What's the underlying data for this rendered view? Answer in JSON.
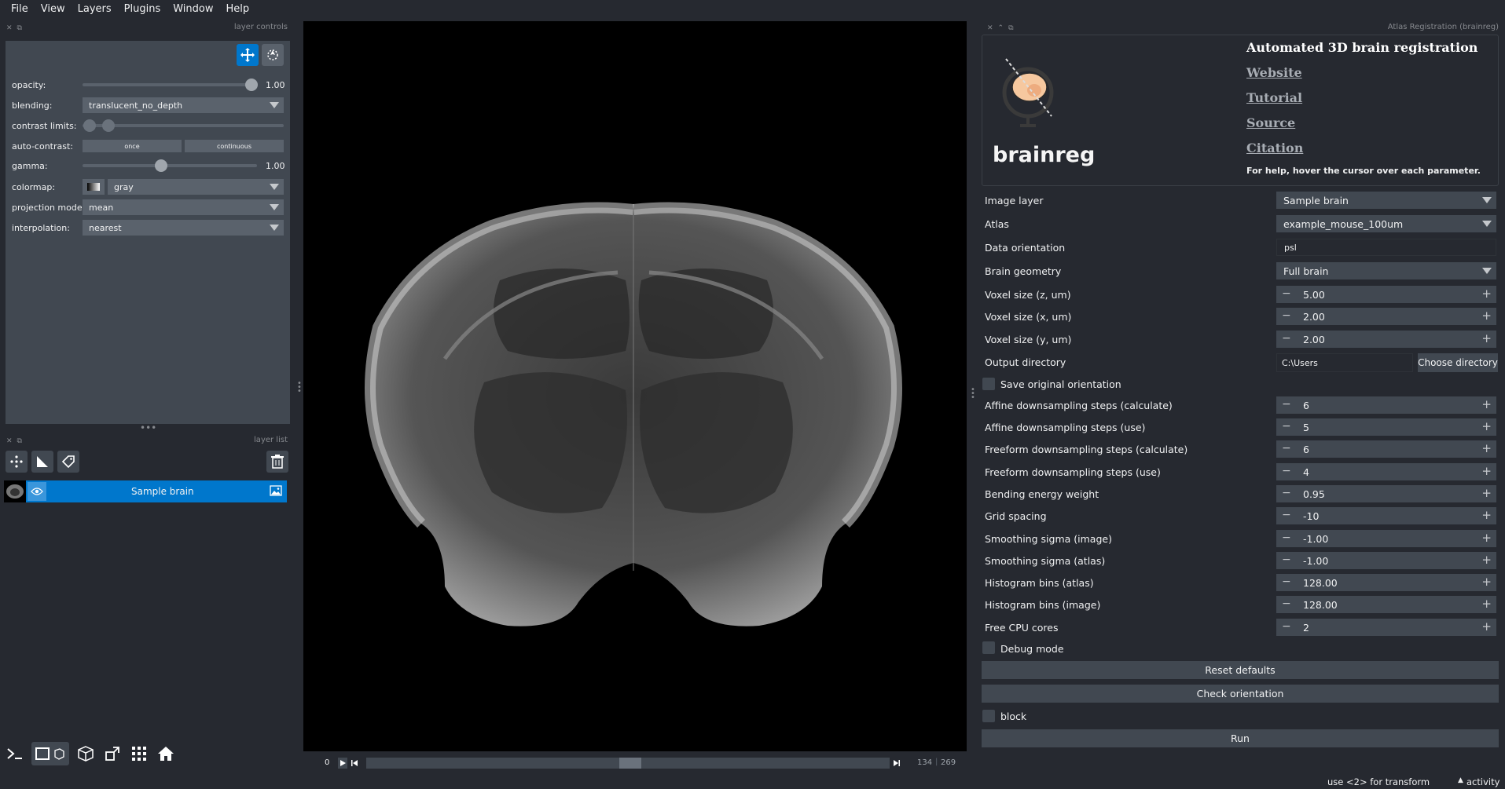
{
  "menu": [
    "File",
    "View",
    "Layers",
    "Plugins",
    "Window",
    "Help"
  ],
  "layer_controls": {
    "title": "layer controls",
    "opacity": {
      "label": "opacity:",
      "value": "1.00",
      "fraction": 1.0
    },
    "blending": {
      "label": "blending:",
      "value": "translucent_no_depth"
    },
    "contrast_limits": {
      "label": "contrast limits:"
    },
    "auto_contrast": {
      "label": "auto-contrast:",
      "once": "once",
      "continuous": "continuous"
    },
    "gamma": {
      "label": "gamma:",
      "value": "1.00"
    },
    "colormap": {
      "label": "colormap:",
      "value": "gray"
    },
    "projection_mode": {
      "label": "projection mode:",
      "value": "mean"
    },
    "interpolation": {
      "label": "interpolation:",
      "value": "nearest"
    }
  },
  "layer_list": {
    "title": "layer list",
    "layers": [
      {
        "name": "Sample brain"
      }
    ]
  },
  "dims": {
    "start": "0",
    "current": "134",
    "total": "269"
  },
  "plugin": {
    "title": "Atlas Registration (brainreg)",
    "heading": "Automated 3D brain registration",
    "app_name": "brainreg",
    "links": [
      "Website",
      "Tutorial",
      "Source",
      "Citation"
    ],
    "help_text": "For help, hover the cursor over each parameter.",
    "image_layer": {
      "label": "Image layer",
      "value": "Sample brain"
    },
    "atlas": {
      "label": "Atlas",
      "value": "example_mouse_100um"
    },
    "data_orientation": {
      "label": "Data orientation",
      "value": "psl"
    },
    "brain_geometry": {
      "label": "Brain geometry",
      "value": "Full brain"
    },
    "spinners_a": [
      {
        "label": "Voxel size (z, um)",
        "value": "5.00"
      },
      {
        "label": "Voxel size (x, um)",
        "value": "2.00"
      },
      {
        "label": "Voxel size (y, um)",
        "value": "2.00"
      }
    ],
    "output_directory": {
      "label": "Output directory",
      "value": "C:\\Users",
      "button": "Choose directory"
    },
    "save_original_orientation": "Save original orientation",
    "spinners_b": [
      {
        "label": "Affine downsampling steps (calculate)",
        "value": "6"
      },
      {
        "label": "Affine downsampling steps (use)",
        "value": "5"
      },
      {
        "label": "Freeform downsampling steps (calculate)",
        "value": "6"
      },
      {
        "label": "Freeform downsampling steps (use)",
        "value": "4"
      },
      {
        "label": "Bending energy weight",
        "value": "0.95"
      },
      {
        "label": "Grid spacing",
        "value": "-10"
      },
      {
        "label": "Smoothing sigma (image)",
        "value": "-1.00"
      },
      {
        "label": "Smoothing sigma (atlas)",
        "value": "-1.00"
      },
      {
        "label": "Histogram bins (atlas)",
        "value": "128.00"
      },
      {
        "label": "Histogram bins (image)",
        "value": "128.00"
      },
      {
        "label": "Free CPU cores",
        "value": "2"
      }
    ],
    "debug_mode": "Debug mode",
    "reset_defaults": "Reset defaults",
    "check_orientation": "Check orientation",
    "block": "block",
    "run": "Run"
  },
  "status": {
    "hint": "use <2> for transform",
    "activity": "activity"
  },
  "colors": {
    "accent": "#0077cc",
    "background": "#262930",
    "panel": "#414851"
  }
}
